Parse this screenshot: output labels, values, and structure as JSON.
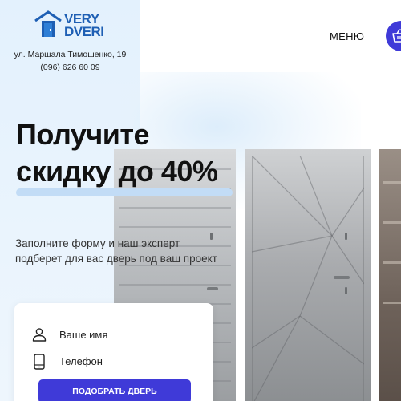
{
  "header": {
    "logo": {
      "line1": "VERY",
      "line2": "DVERI"
    },
    "address": "ул. Маршала Тимошенко, 19",
    "phone": "(096) 626 60 09",
    "menu_label": "МЕНЮ",
    "cart_icon": "basket-icon"
  },
  "hero": {
    "title_line1": "Получите",
    "title_line2": "скидку до 40%",
    "subtitle_line1": "Заполните форму и наш эксперт",
    "subtitle_line2": "подберет для вас дверь под ваш проект"
  },
  "form": {
    "name_placeholder": "Ваше имя",
    "phone_placeholder": "Телефон",
    "submit_label": "ПОДОБРАТЬ ДВЕРЬ"
  },
  "colors": {
    "brand_blue": "#1e5fb4",
    "accent_purple": "#3f3ad8",
    "panel_blue": "#e3f1fd",
    "underline_blue": "#c2dcf6"
  }
}
